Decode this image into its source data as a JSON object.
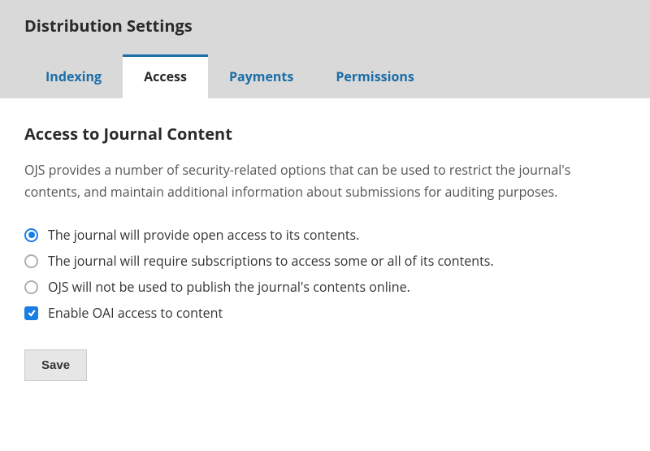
{
  "header": {
    "title": "Distribution Settings"
  },
  "tabs": [
    {
      "label": "Indexing",
      "active": false
    },
    {
      "label": "Access",
      "active": true
    },
    {
      "label": "Payments",
      "active": false
    },
    {
      "label": "Permissions",
      "active": false
    }
  ],
  "section": {
    "title": "Access to Journal Content",
    "description": "OJS provides a number of security-related options that can be used to restrict the journal's contents, and maintain additional information about submissions for auditing purposes."
  },
  "options": {
    "radio": [
      {
        "label": "The journal will provide open access to its contents.",
        "checked": true
      },
      {
        "label": "The journal will require subscriptions to access some or all of its contents.",
        "checked": false
      },
      {
        "label": "OJS will not be used to publish the journal's contents online.",
        "checked": false
      }
    ],
    "checkbox": {
      "label": "Enable OAI access to content",
      "checked": true
    }
  },
  "buttons": {
    "save": "Save"
  }
}
